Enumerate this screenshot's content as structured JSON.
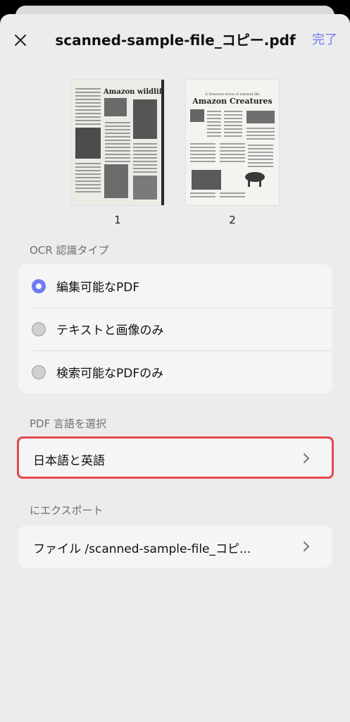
{
  "header": {
    "title": "scanned-sample-file_コピー.pdf",
    "done_label": "完了"
  },
  "pages": [
    {
      "number": "1",
      "heading": "Amazon wildlife"
    },
    {
      "number": "2",
      "subheading": "A treasure trove of natural life",
      "heading": "Amazon Creatures"
    }
  ],
  "ocr": {
    "section_label": "OCR 認識タイプ",
    "options": [
      {
        "label": "編集可能なPDF",
        "selected": true
      },
      {
        "label": "テキストと画像のみ",
        "selected": false
      },
      {
        "label": "検索可能なPDFのみ",
        "selected": false
      }
    ]
  },
  "language": {
    "section_label": "PDF 言語を選択",
    "value": "日本語と英語"
  },
  "export": {
    "section_label": "にエクスポート",
    "value": "ファイル /scanned-sample-file_コピ..."
  },
  "colors": {
    "accent": "#6e7cf2",
    "highlight": "#e5484d",
    "background": "#ececec"
  }
}
